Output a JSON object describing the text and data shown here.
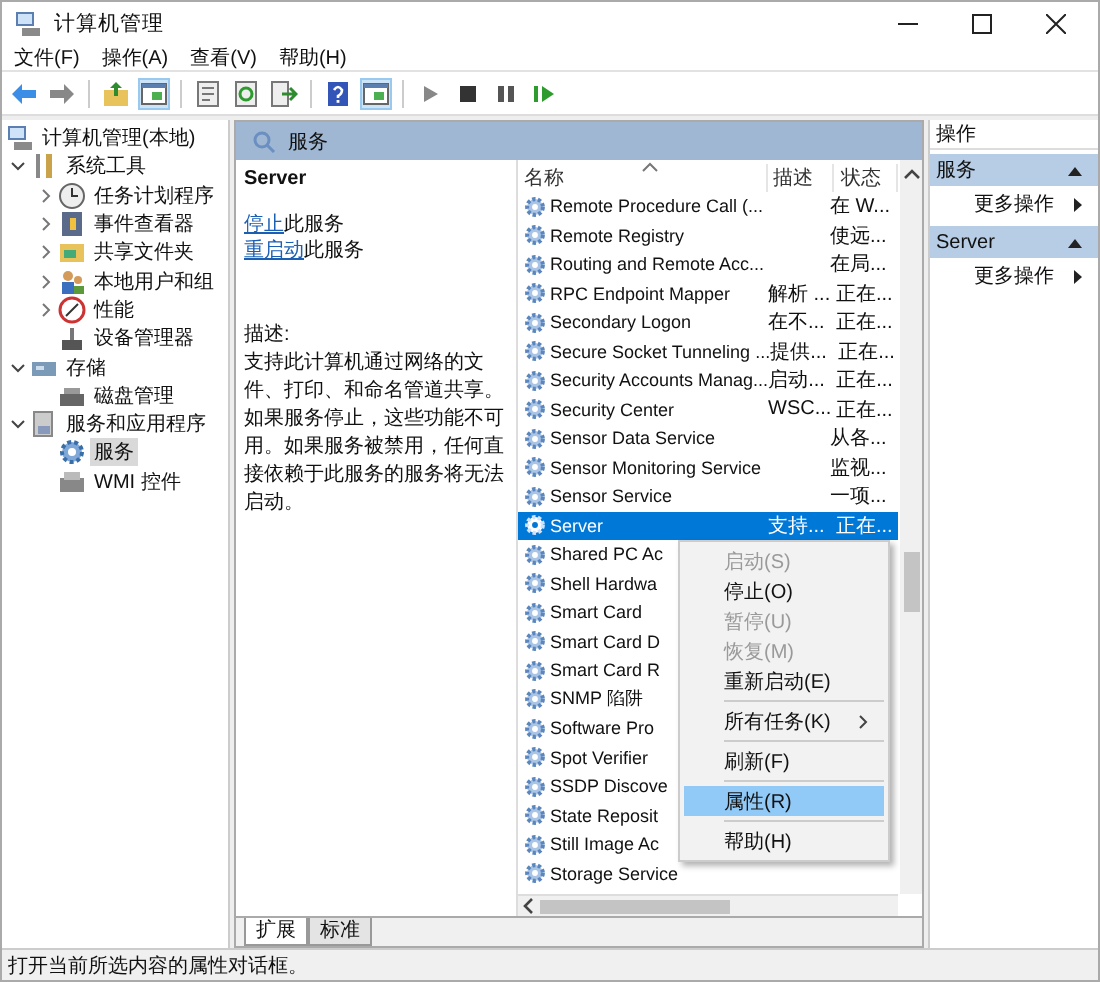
{
  "window": {
    "title": "计算机管理"
  },
  "menu_bar": [
    "文件(F)",
    "操作(A)",
    "查看(V)",
    "帮助(H)"
  ],
  "toolbar": [
    {
      "kind": "back",
      "pressed": false
    },
    {
      "kind": "forward",
      "pressed": false
    },
    {
      "kind": "separator"
    },
    {
      "kind": "up",
      "pressed": false
    },
    {
      "kind": "tree",
      "pressed": true
    },
    {
      "kind": "separator"
    },
    {
      "kind": "properties",
      "pressed": false
    },
    {
      "kind": "refresh",
      "pressed": false
    },
    {
      "kind": "export",
      "pressed": false
    },
    {
      "kind": "separator"
    },
    {
      "kind": "help",
      "pressed": false
    },
    {
      "kind": "pane",
      "pressed": true
    },
    {
      "kind": "separator"
    },
    {
      "kind": "play",
      "pressed": false
    },
    {
      "kind": "stop",
      "pressed": false
    },
    {
      "kind": "pause",
      "pressed": false
    },
    {
      "kind": "restart",
      "pressed": false
    }
  ],
  "tree": [
    {
      "label": "计算机管理(本地)",
      "selected": false,
      "children": [
        {
          "label": "系统工具",
          "expanded": true,
          "selected": false,
          "children": [
            {
              "label": "任务计划程序",
              "expanded": false,
              "selected": false
            },
            {
              "label": "事件查看器",
              "expanded": false,
              "selected": false
            },
            {
              "label": "共享文件夹",
              "expanded": false,
              "selected": false
            },
            {
              "label": "本地用户和组",
              "expanded": false,
              "selected": false
            },
            {
              "label": "性能",
              "expanded": false,
              "selected": false
            },
            {
              "label": "设备管理器",
              "selected": false
            }
          ]
        },
        {
          "label": "存储",
          "expanded": true,
          "selected": false,
          "children": [
            {
              "label": "磁盘管理",
              "selected": false
            }
          ]
        },
        {
          "label": "服务和应用程序",
          "expanded": true,
          "selected": false,
          "children": [
            {
              "label": "服务",
              "selected": true
            },
            {
              "label": "WMI 控件",
              "selected": false
            }
          ]
        }
      ]
    }
  ],
  "services_panel": {
    "title": "服务",
    "detail_title": "Server",
    "actions": [
      {
        "link": "停止",
        "text": "此服务"
      },
      {
        "link": "重启动",
        "text": "此服务"
      }
    ],
    "description_label": "描述:",
    "description": "支持此计算机通过网络的文件、打印、和命名管道共享。如果服务停止，这些功能不可用。如果服务被禁用，任何直接依赖于此服务的服务将无法启动。",
    "columns": [
      "名称",
      "描述",
      "状态"
    ],
    "rows": [
      {
        "name": "Remote Procedure Call (...",
        "description": "在 W...",
        "status": "",
        "selected": false
      },
      {
        "name": "Remote Registry",
        "description": "使远...",
        "status": "",
        "selected": false
      },
      {
        "name": "Routing and Remote Acc...",
        "description": "在局...",
        "status": "",
        "selected": false
      },
      {
        "name": "RPC Endpoint Mapper",
        "description": "解析 ...",
        "status": "正在...",
        "selected": false
      },
      {
        "name": "Secondary Logon",
        "description": "在不...",
        "status": "正在...",
        "selected": false
      },
      {
        "name": "Secure Socket Tunneling ...",
        "description": "提供...",
        "status": "正在...",
        "selected": false
      },
      {
        "name": "Security Accounts Manag...",
        "description": "启动...",
        "status": "正在...",
        "selected": false
      },
      {
        "name": "Security Center",
        "description": "WSC...",
        "status": "正在...",
        "selected": false
      },
      {
        "name": "Sensor Data Service",
        "description": "从各...",
        "status": "",
        "selected": false
      },
      {
        "name": "Sensor Monitoring Service",
        "description": "监视...",
        "status": "",
        "selected": false
      },
      {
        "name": "Sensor Service",
        "description": "一项...",
        "status": "",
        "selected": false
      },
      {
        "name": "Server",
        "description": "支持...",
        "status": "正在...",
        "selected": true
      },
      {
        "name": "Shared PC Ac",
        "description": "",
        "status": "",
        "selected": false
      },
      {
        "name": "Shell Hardwa",
        "description": "",
        "status": "",
        "selected": false
      },
      {
        "name": "Smart Card",
        "description": "",
        "status": "",
        "selected": false
      },
      {
        "name": "Smart Card D",
        "description": "",
        "status": "",
        "selected": false
      },
      {
        "name": "Smart Card R",
        "description": "",
        "status": "",
        "selected": false
      },
      {
        "name": "SNMP 陷阱",
        "description": "",
        "status": "",
        "selected": false
      },
      {
        "name": "Software Pro",
        "description": "",
        "status": "",
        "selected": false
      },
      {
        "name": "Spot Verifier",
        "description": "",
        "status": "",
        "selected": false
      },
      {
        "name": "SSDP Discove",
        "description": "",
        "status": "",
        "selected": false
      },
      {
        "name": "State Reposit",
        "description": "",
        "status": "",
        "selected": false
      },
      {
        "name": "Still Image Ac",
        "description": "",
        "status": "",
        "selected": false
      },
      {
        "name": "Storage Service",
        "description": "",
        "status": "",
        "selected": false
      }
    ],
    "tabs": [
      {
        "label": "扩展",
        "selected": true
      },
      {
        "label": "标准",
        "selected": false
      }
    ]
  },
  "context_menu": [
    {
      "kind": "item",
      "label": "启动(S)",
      "disabled": true,
      "selected": false,
      "submenu": false
    },
    {
      "kind": "item",
      "label": "停止(O)",
      "disabled": false,
      "selected": false,
      "submenu": false
    },
    {
      "kind": "item",
      "label": "暂停(U)",
      "disabled": true,
      "selected": false,
      "submenu": false
    },
    {
      "kind": "item",
      "label": "恢复(M)",
      "disabled": true,
      "selected": false,
      "submenu": false
    },
    {
      "kind": "item",
      "label": "重新启动(E)",
      "disabled": false,
      "selected": false,
      "submenu": false
    },
    {
      "kind": "separator"
    },
    {
      "kind": "item",
      "label": "所有任务(K)",
      "disabled": false,
      "selected": false,
      "submenu": true
    },
    {
      "kind": "separator"
    },
    {
      "kind": "item",
      "label": "刷新(F)",
      "disabled": false,
      "selected": false,
      "submenu": false
    },
    {
      "kind": "separator"
    },
    {
      "kind": "item",
      "label": "属性(R)",
      "disabled": false,
      "selected": true,
      "submenu": false
    },
    {
      "kind": "separator"
    },
    {
      "kind": "item",
      "label": "帮助(H)",
      "disabled": false,
      "selected": false,
      "submenu": false
    }
  ],
  "actions_pane": {
    "title": "操作",
    "items": [
      {
        "kind": "header",
        "label": "服务",
        "expanded": true
      },
      {
        "kind": "link",
        "label": "更多操作"
      },
      {
        "kind": "header",
        "label": "Server",
        "expanded": true
      },
      {
        "kind": "link",
        "label": "更多操作"
      }
    ]
  },
  "status_bar": "打开当前所选内容的属性对话框。"
}
